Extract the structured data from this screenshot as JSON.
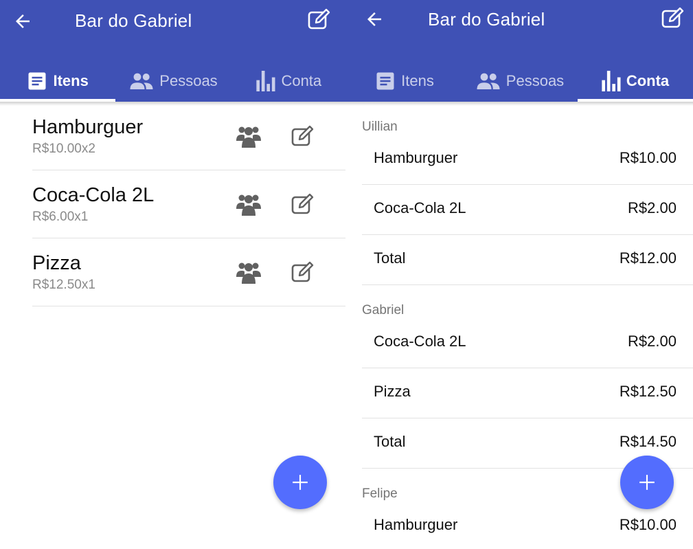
{
  "colors": {
    "primary": "#3f51b5",
    "accent": "#536dfe",
    "icon_gray": "#616161"
  },
  "app": {
    "title": "Bar do Gabriel"
  },
  "tabs": [
    {
      "label": "Itens",
      "icon": "list-icon"
    },
    {
      "label": "Pessoas",
      "icon": "people-icon"
    },
    {
      "label": "Conta",
      "icon": "bar-chart-icon"
    }
  ],
  "left_screen": {
    "active_tab": "Itens"
  },
  "right_screen": {
    "active_tab": "Conta"
  },
  "items": [
    {
      "name": "Hamburguer",
      "price": "R$10.00x2"
    },
    {
      "name": "Coca-Cola 2L",
      "price": "R$6.00x1"
    },
    {
      "name": "Pizza",
      "price": "R$12.50x1"
    }
  ],
  "bill": [
    {
      "person": "Uillian",
      "rows": [
        {
          "label": "Hamburguer",
          "value": "R$10.00"
        },
        {
          "label": "Coca-Cola 2L",
          "value": "R$2.00"
        },
        {
          "label": "Total",
          "value": "R$12.00"
        }
      ]
    },
    {
      "person": "Gabriel",
      "rows": [
        {
          "label": "Coca-Cola 2L",
          "value": "R$2.00"
        },
        {
          "label": "Pizza",
          "value": "R$12.50"
        },
        {
          "label": "Total",
          "value": "R$14.50"
        }
      ]
    },
    {
      "person": "Felipe",
      "rows": [
        {
          "label": "Hamburguer",
          "value": "R$10.00"
        }
      ]
    }
  ]
}
